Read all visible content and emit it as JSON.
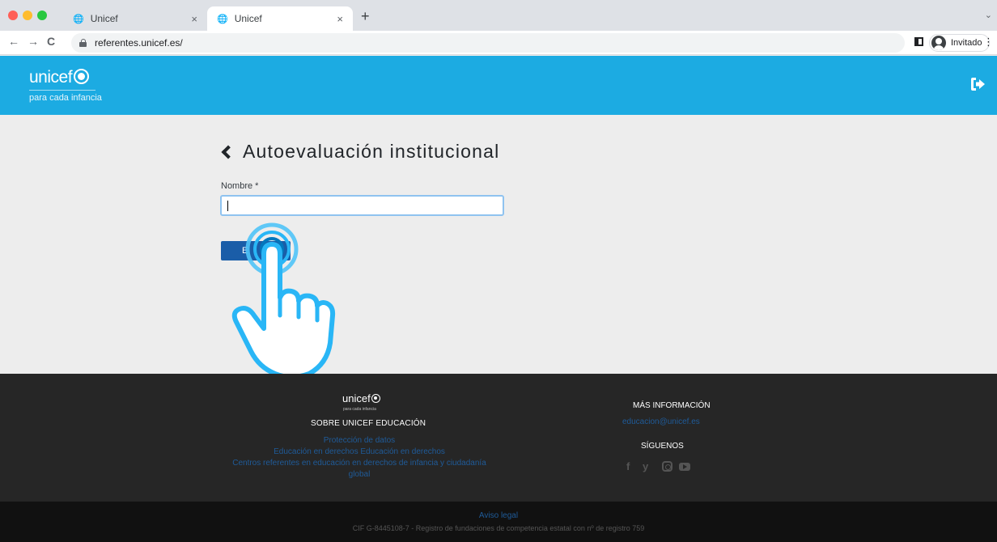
{
  "browser": {
    "tabs": [
      {
        "title": "Unicef",
        "active": false
      },
      {
        "title": "Unicef",
        "active": true
      }
    ],
    "close_glyph": "×",
    "newtab_glyph": "+",
    "favicon_glyph": "🌐",
    "url": "referentes.unicef.es/",
    "profile_label": "Invitado",
    "nav": {
      "back": "←",
      "forward": "→",
      "reload": "C"
    },
    "tabs_menu_glyph": "⌄",
    "menu_glyph": "⋮"
  },
  "header": {
    "logo_text": "unicef",
    "tagline": "para cada infancia"
  },
  "form": {
    "title": "Autoevaluación institucional",
    "name_label": "Nombre *",
    "name_value": "",
    "submit_label": "E"
  },
  "footer": {
    "logo_text": "unicef",
    "tagline": "para cada infancia",
    "about_heading": "SOBRE UNICEF EDUCACIÓN",
    "links": [
      "Protección de datos",
      "Educación en derechos Educación en derechos",
      "Centros referentes en educación en derechos de infancia y ciudadanía",
      "global"
    ],
    "more_heading": "MÁS INFORMACIÓN",
    "email": "educacion@unicef.es",
    "follow_heading": "SÍGUENOS",
    "social": {
      "facebook": "f",
      "twitter": "y"
    }
  },
  "legal": {
    "link": "Aviso legal",
    "text": "CIF G-8445108-7 - Registro de fundaciones de competencia estatal con nº de registro 759"
  },
  "colors": {
    "brand_blue": "#1cabe2",
    "button_blue": "#1a5da8",
    "footer_dark": "#262626",
    "legal_dark": "#111111",
    "link_blue": "#1f5b99"
  },
  "icons": {
    "logout": "logout-icon",
    "back": "chevron-left-icon",
    "hand": "pointing-hand-icon"
  }
}
